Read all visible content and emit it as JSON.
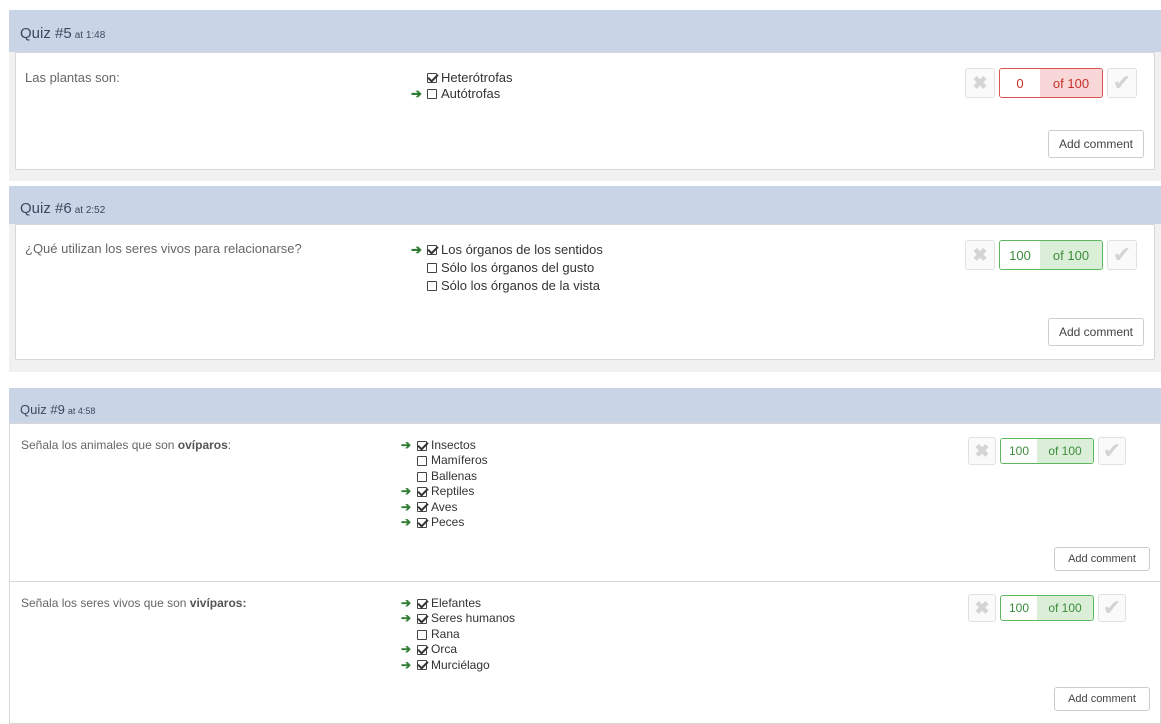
{
  "quiz5": {
    "title": "Quiz #5",
    "time": "at 1:48",
    "question": "Las plantas son:",
    "answers": [
      "Heterótrofas",
      "Autótrofas"
    ],
    "score": "0",
    "of": "of 100",
    "comment_label": "Add comment"
  },
  "quiz6": {
    "title": "Quiz #6",
    "time": "at 2:52",
    "question": "¿Qué utilizan los seres vivos para relacionarse?",
    "answers": [
      "Los órganos de los sentidos",
      "Sólo los órganos del gusto",
      "Sólo los órganos de la vista"
    ],
    "score": "100",
    "of": "of 100",
    "comment_label": "Add comment"
  },
  "quiz9": {
    "title": "Quiz #9",
    "time": "at 4:58",
    "q1": {
      "question_prefix": "Señala los animales que son ",
      "question_bold": "ovíparos",
      "question_suffix": ":",
      "answers": [
        "Insectos",
        "Mamíferos",
        "Ballenas",
        "Reptiles",
        "Aves",
        "Peces"
      ],
      "score": "100",
      "of": "of 100",
      "comment_label": "Add comment"
    },
    "q2": {
      "question_prefix": "Señala los seres vivos que son ",
      "question_bold": "vivíparos:",
      "answers": [
        "Elefantes",
        "Seres humanos",
        "Rana",
        "Orca",
        "Murciélago"
      ],
      "score": "100",
      "of": "of 100",
      "comment_label": "Add comment"
    }
  },
  "icons": {
    "correct_arrow": "arrow-right-icon",
    "checkbox_checked": "checkbox-checked-icon",
    "checkbox_empty": "checkbox-empty-icon",
    "mark_wrong": "x-icon",
    "mark_right": "check-icon"
  },
  "colors": {
    "header_bg": "#c9d5e6",
    "wrong": "#d9534f",
    "right": "#5cb85c",
    "arrow": "#2e7d32"
  }
}
